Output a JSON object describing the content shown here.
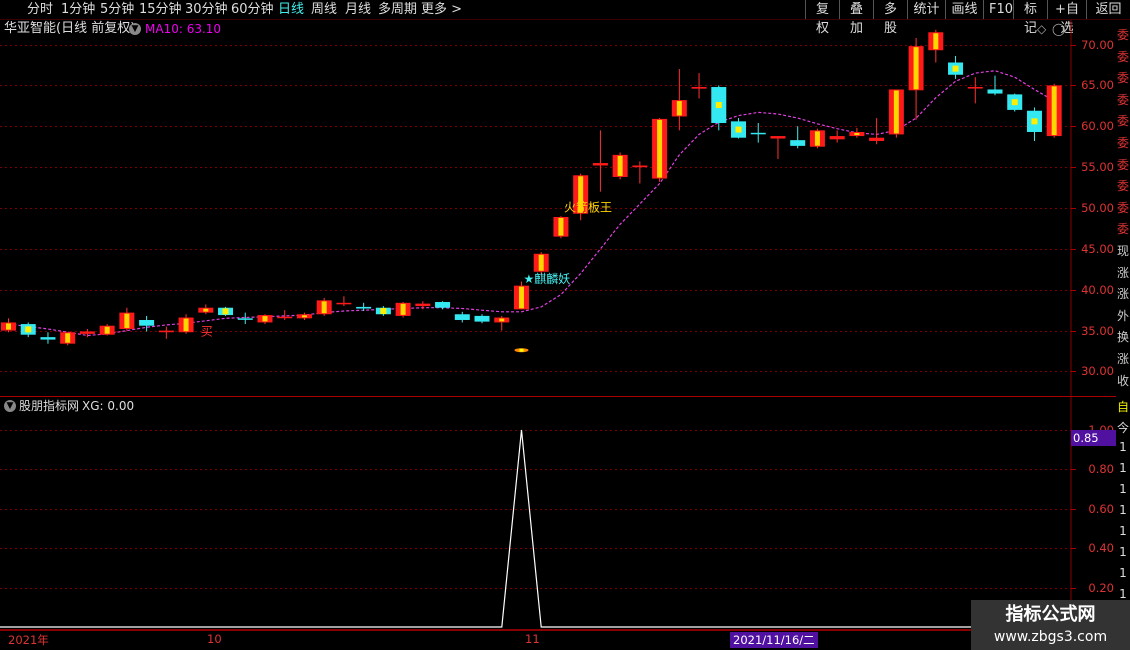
{
  "toolbar": {
    "periods": [
      "分时",
      "1分钟",
      "5分钟",
      "15分钟",
      "30分钟",
      "60分钟",
      "日线",
      "周线",
      "月线",
      "多周期",
      "更多 >"
    ],
    "active_period": "日线",
    "right_buttons": [
      "复权",
      "叠加",
      "多股",
      "统计",
      "画线",
      "F10",
      "标记",
      "+自选",
      "返回"
    ]
  },
  "stock": {
    "name": "华亚智能(日线 前复权)",
    "ma_label": "MA10: 63.10"
  },
  "main_axis": {
    "ticks": [
      "70.00",
      "65.00",
      "60.00",
      "55.00",
      "50.00",
      "45.00",
      "40.00",
      "35.00",
      "30.00"
    ]
  },
  "annotations": {
    "buy": "买",
    "qilin": "★麒麟妖",
    "rocket": "火箭板王"
  },
  "indicator": {
    "name": "股朋指标网",
    "value_label": "XG: 0.00",
    "ticks": [
      "1.00",
      "0.80",
      "0.60",
      "0.40",
      "0.20"
    ],
    "marker": "0.85"
  },
  "date_axis": {
    "labels": [
      "2021年",
      "10",
      "11"
    ],
    "cursor_date": "2021/11/16/二"
  },
  "right_strip": {
    "top_chars": [
      "委",
      "委",
      "委",
      "委",
      "委",
      "委",
      "委",
      "委",
      "委",
      "委",
      "现",
      "涨",
      "涨",
      "外",
      "换",
      "涨",
      "收"
    ],
    "bottom_chars": [
      "自",
      "今",
      "1",
      "1",
      "1",
      "1",
      "1",
      "1",
      "1",
      "1"
    ]
  },
  "watermark": {
    "title": "指标公式网",
    "url": "www.zbgs3.com"
  },
  "chart_data": {
    "type": "candlestick",
    "ylim": [
      27,
      73
    ],
    "candles": [
      {
        "o": 35.0,
        "h": 36.5,
        "l": 34.8,
        "c": 36.0
      },
      {
        "o": 35.8,
        "h": 36.0,
        "l": 34.2,
        "c": 34.5
      },
      {
        "o": 34.2,
        "h": 34.8,
        "l": 33.4,
        "c": 33.9
      },
      {
        "o": 33.4,
        "h": 34.8,
        "l": 33.2,
        "c": 34.8
      },
      {
        "o": 34.6,
        "h": 35.2,
        "l": 34.2,
        "c": 34.9
      },
      {
        "o": 34.5,
        "h": 35.8,
        "l": 34.4,
        "c": 35.6
      },
      {
        "o": 35.2,
        "h": 37.8,
        "l": 35.0,
        "c": 37.2
      },
      {
        "o": 36.3,
        "h": 36.8,
        "l": 34.9,
        "c": 35.6
      },
      {
        "o": 34.8,
        "h": 35.5,
        "l": 34.0,
        "c": 35.0
      },
      {
        "o": 34.8,
        "h": 37.0,
        "l": 34.6,
        "c": 36.6
      },
      {
        "o": 37.2,
        "h": 38.2,
        "l": 37.0,
        "c": 37.8
      },
      {
        "o": 37.8,
        "h": 37.9,
        "l": 36.8,
        "c": 36.9
      },
      {
        "o": 36.5,
        "h": 37.2,
        "l": 35.8,
        "c": 36.4
      },
      {
        "o": 36.0,
        "h": 37.0,
        "l": 35.8,
        "c": 36.9
      },
      {
        "o": 36.6,
        "h": 37.5,
        "l": 36.3,
        "c": 36.7
      },
      {
        "o": 36.5,
        "h": 37.2,
        "l": 36.3,
        "c": 37.0
      },
      {
        "o": 37.0,
        "h": 39.0,
        "l": 36.8,
        "c": 38.7
      },
      {
        "o": 38.3,
        "h": 39.2,
        "l": 38.0,
        "c": 38.4
      },
      {
        "o": 37.9,
        "h": 38.4,
        "l": 37.4,
        "c": 37.7
      },
      {
        "o": 37.8,
        "h": 38.0,
        "l": 36.8,
        "c": 37.0
      },
      {
        "o": 36.8,
        "h": 38.5,
        "l": 36.6,
        "c": 38.4
      },
      {
        "o": 38.0,
        "h": 38.6,
        "l": 37.6,
        "c": 38.3
      },
      {
        "o": 38.5,
        "h": 38.6,
        "l": 37.6,
        "c": 37.8
      },
      {
        "o": 37.0,
        "h": 37.3,
        "l": 36.0,
        "c": 36.3
      },
      {
        "o": 36.8,
        "h": 37.0,
        "l": 35.9,
        "c": 36.1
      },
      {
        "o": 36.0,
        "h": 36.8,
        "l": 35.0,
        "c": 36.6
      },
      {
        "o": 37.6,
        "h": 41.0,
        "l": 37.6,
        "c": 40.5
      },
      {
        "o": 42.2,
        "h": 44.6,
        "l": 41.8,
        "c": 44.4
      },
      {
        "o": 46.5,
        "h": 49.0,
        "l": 46.3,
        "c": 48.9
      },
      {
        "o": 49.3,
        "h": 54.2,
        "l": 48.5,
        "c": 54.0
      },
      {
        "o": 55.2,
        "h": 59.5,
        "l": 52.0,
        "c": 55.5
      },
      {
        "o": 53.8,
        "h": 56.8,
        "l": 53.5,
        "c": 56.5
      },
      {
        "o": 55.0,
        "h": 55.7,
        "l": 53.0,
        "c": 55.2
      },
      {
        "o": 53.6,
        "h": 61.0,
        "l": 53.2,
        "c": 60.9
      },
      {
        "o": 61.2,
        "h": 67.0,
        "l": 59.5,
        "c": 63.2
      },
      {
        "o": 64.6,
        "h": 66.5,
        "l": 63.4,
        "c": 64.8
      },
      {
        "o": 64.8,
        "h": 65.0,
        "l": 59.5,
        "c": 60.4
      },
      {
        "o": 60.6,
        "h": 61.0,
        "l": 58.5,
        "c": 58.6
      },
      {
        "o": 59.2,
        "h": 60.4,
        "l": 58.0,
        "c": 59.1
      },
      {
        "o": 58.5,
        "h": 58.8,
        "l": 56.0,
        "c": 58.8
      },
      {
        "o": 58.3,
        "h": 60.0,
        "l": 57.3,
        "c": 57.6
      },
      {
        "o": 57.5,
        "h": 59.7,
        "l": 57.3,
        "c": 59.5
      },
      {
        "o": 58.4,
        "h": 59.5,
        "l": 58.0,
        "c": 58.8
      },
      {
        "o": 58.8,
        "h": 59.8,
        "l": 58.6,
        "c": 59.3
      },
      {
        "o": 58.2,
        "h": 61.0,
        "l": 57.8,
        "c": 58.6
      },
      {
        "o": 59.0,
        "h": 64.5,
        "l": 58.6,
        "c": 64.5
      },
      {
        "o": 64.4,
        "h": 70.8,
        "l": 60.8,
        "c": 69.8
      },
      {
        "o": 69.3,
        "h": 71.8,
        "l": 67.8,
        "c": 71.5
      },
      {
        "o": 67.8,
        "h": 68.6,
        "l": 65.8,
        "c": 66.3
      },
      {
        "o": 64.8,
        "h": 66.0,
        "l": 62.8,
        "c": 64.8
      },
      {
        "o": 64.5,
        "h": 66.2,
        "l": 63.8,
        "c": 64.0
      },
      {
        "o": 63.9,
        "h": 64.0,
        "l": 61.8,
        "c": 62.0
      },
      {
        "o": 61.9,
        "h": 62.3,
        "l": 58.2,
        "c": 59.3
      },
      {
        "o": 58.8,
        "h": 65.2,
        "l": 58.6,
        "c": 65.0
      }
    ],
    "ma10": [
      35.8,
      35.5,
      35.2,
      34.8,
      34.4,
      34.6,
      35.0,
      35.4,
      35.7,
      35.9,
      36.2,
      36.5,
      36.6,
      36.7,
      36.8,
      36.9,
      37.2,
      37.4,
      37.5,
      37.6,
      37.7,
      37.8,
      37.8,
      37.7,
      37.5,
      37.3,
      37.3,
      37.9,
      39.4,
      42.0,
      45.0,
      48.0,
      50.5,
      53.0,
      56.5,
      59.0,
      60.5,
      61.3,
      61.7,
      61.5,
      61.0,
      60.3,
      59.7,
      59.2,
      59.0,
      59.5,
      61.0,
      63.5,
      65.5,
      66.5,
      66.8,
      66.0,
      64.5,
      63.1
    ],
    "signals": [
      {
        "index": 0,
        "label": "买"
      },
      {
        "index": 26,
        "label": "★麒麟妖"
      },
      {
        "index": 28,
        "label": "火箭板王"
      }
    ],
    "indicator": {
      "name": "XG",
      "ylim": [
        0,
        1.05
      ],
      "values": [
        0,
        0,
        0,
        0,
        0,
        0,
        0,
        0,
        0,
        0,
        0,
        0,
        0,
        0,
        0,
        0,
        0,
        0,
        0,
        0,
        0,
        0,
        0,
        0,
        0,
        0,
        1,
        0,
        0,
        0,
        0,
        0,
        0,
        0,
        0,
        0,
        0,
        0,
        0,
        0,
        0,
        0,
        0,
        0,
        0,
        0,
        0,
        0,
        0,
        0,
        0,
        0,
        0,
        0
      ]
    }
  }
}
